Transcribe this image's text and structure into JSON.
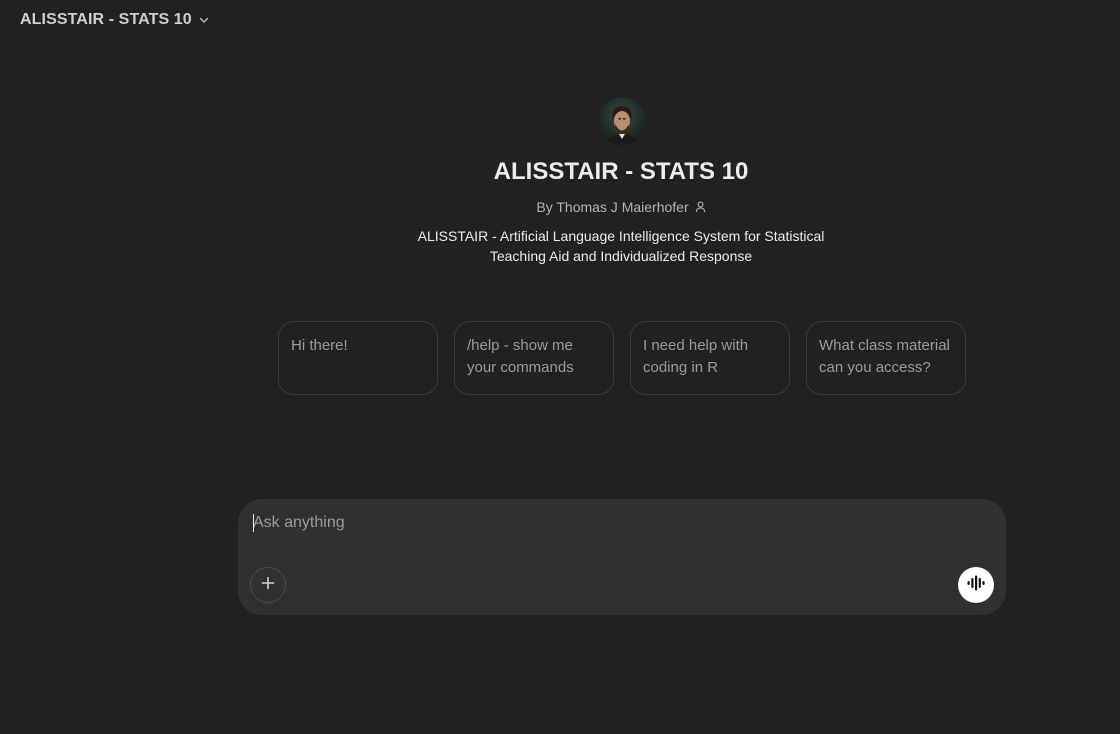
{
  "header": {
    "model_title": "ALISSTAIR - STATS 10",
    "chevron_icon": "chevron-down-icon"
  },
  "gpt": {
    "name": "ALISSTAIR - STATS 10",
    "byline": "By Thomas J Maierhofer",
    "description_line1": "ALISSTAIR - Artificial Language Intelligence System for Statistical",
    "description_line2": "Teaching Aid and Individualized Response",
    "avatar_icon": "portrait-avatar"
  },
  "starters": [
    {
      "label": "Hi there!"
    },
    {
      "label": "/help - show me your commands"
    },
    {
      "label": "I need help with coding in R"
    },
    {
      "label": "What class material can you access?"
    }
  ],
  "composer": {
    "placeholder": "Ask anything",
    "value": "",
    "attach_icon": "plus-icon",
    "voice_icon": "voice-waveform-icon"
  },
  "colors": {
    "background": "#212121",
    "composer": "#303030",
    "text": "#ececec",
    "muted": "#9b9b9b"
  }
}
